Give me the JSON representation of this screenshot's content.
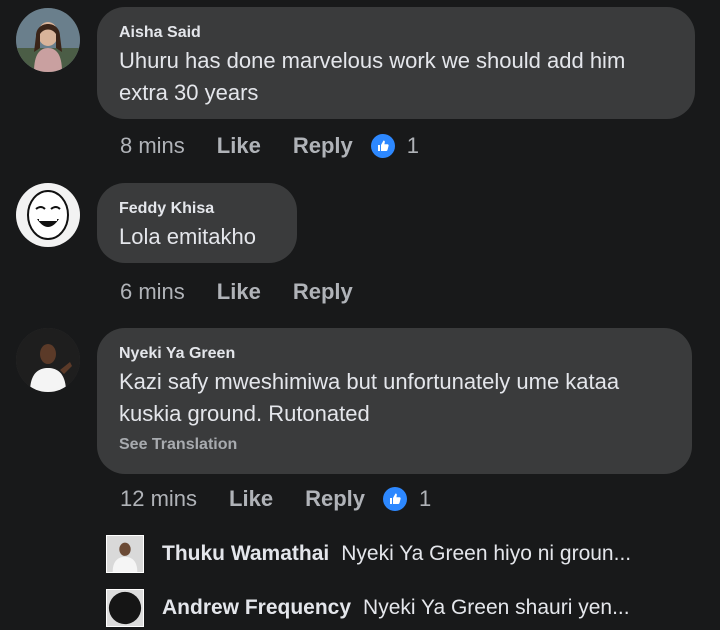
{
  "comments": [
    {
      "author": "Aisha Said",
      "text_line1": "Uhuru has done marvelous work we should add him",
      "text_line2": "extra 30 years",
      "time": "8 mins",
      "like_label": "Like",
      "reply_label": "Reply",
      "reaction_icon": "thumbs-up-icon",
      "reaction_count": "1"
    },
    {
      "author": "Feddy Khisa",
      "text_line1": "Lola emitakho",
      "time": "6 mins",
      "like_label": "Like",
      "reply_label": "Reply"
    },
    {
      "author": "Nyeki Ya Green",
      "text_line1": "Kazi safy mweshimiwa but unfortunately ume kataa",
      "text_line2": "kuskia ground. Rutonated",
      "see_translation": "See Translation",
      "time": "12 mins",
      "like_label": "Like",
      "reply_label": "Reply",
      "reaction_icon": "thumbs-up-icon",
      "reaction_count": "1"
    }
  ],
  "replies": [
    {
      "author": "Thuku Wamathai",
      "snippet": "Nyeki Ya Green hiyo ni groun..."
    },
    {
      "author": "Andrew Frequency",
      "snippet": "Nyeki Ya Green  shauri yen..."
    }
  ],
  "colors": {
    "background": "#18191a",
    "bubble": "#3a3b3c",
    "primary_text": "#e4e6eb",
    "secondary_text": "#b0b3b8",
    "reaction_blue": "#2d88ff"
  }
}
